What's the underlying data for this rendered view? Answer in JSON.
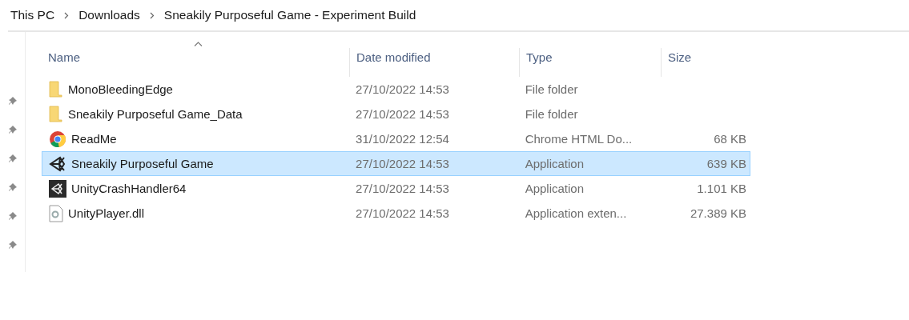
{
  "breadcrumb": [
    "This PC",
    "Downloads",
    "Sneakily Purposeful Game - Experiment Build"
  ],
  "quick_access": {
    "pinned_count_items": [
      {
        "pinned": true
      },
      {
        "pinned": true
      },
      {
        "pinned": true
      },
      {
        "pinned": true
      },
      {
        "pinned": true
      },
      {
        "pinned": true
      }
    ]
  },
  "table": {
    "columns": [
      {
        "label": "Name",
        "sorted": true
      },
      {
        "label": "Date modified",
        "sorted": false
      },
      {
        "label": "Type",
        "sorted": false
      },
      {
        "label": "Size",
        "sorted": false
      }
    ],
    "rows": [
      {
        "kind": "folder",
        "name": "MonoBleedingEdge",
        "date": "27/10/2022 14:53",
        "type": "File folder",
        "size": "",
        "selected": false
      },
      {
        "kind": "folder",
        "name": "Sneakily Purposeful Game_Data",
        "date": "27/10/2022 14:53",
        "type": "File folder",
        "size": "",
        "selected": false
      },
      {
        "kind": "chrome",
        "name": "ReadMe",
        "date": "31/10/2022 12:54",
        "type": "Chrome HTML Do...",
        "size": "68 KB",
        "selected": false
      },
      {
        "kind": "unity",
        "name": "Sneakily Purposeful Game",
        "date": "27/10/2022 14:53",
        "type": "Application",
        "size": "639 KB",
        "selected": true
      },
      {
        "kind": "unity-dark",
        "name": "UnityCrashHandler64",
        "date": "27/10/2022 14:53",
        "type": "Application",
        "size": "1.101 KB",
        "selected": false
      },
      {
        "kind": "dll",
        "name": "UnityPlayer.dll",
        "date": "27/10/2022 14:53",
        "type": "Application exten...",
        "size": "27.389 KB",
        "selected": false
      }
    ]
  }
}
